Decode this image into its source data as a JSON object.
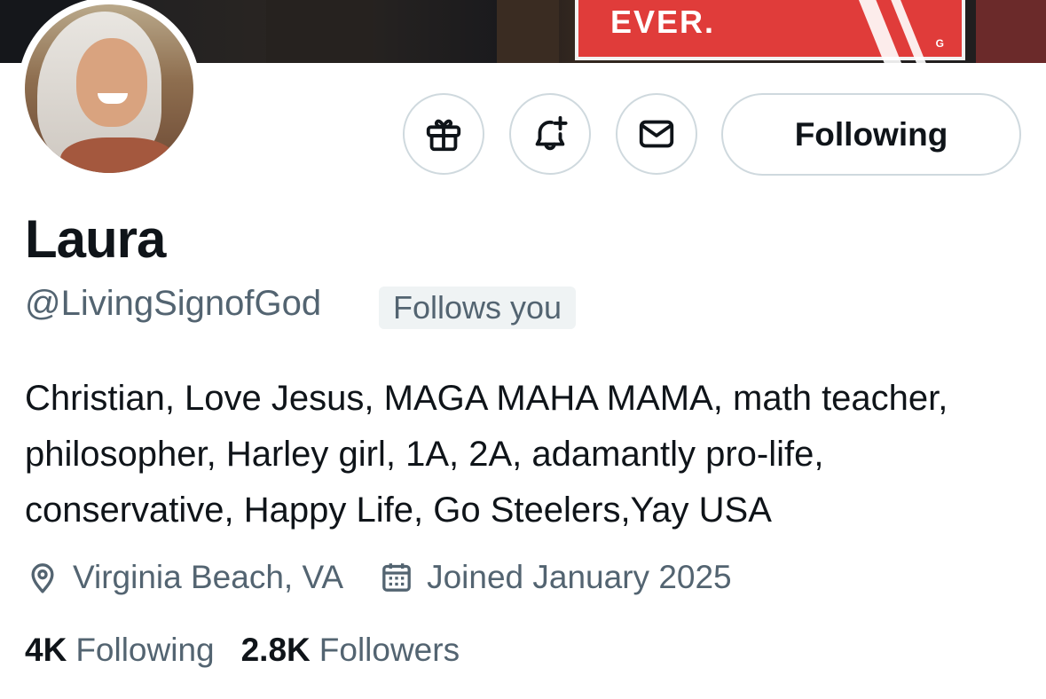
{
  "banner": {
    "sign_text": "EVER."
  },
  "profile": {
    "display_name": "Laura",
    "handle": "@LivingSignofGod",
    "follows_you_badge": "Follows you",
    "bio": "Christian, Love Jesus, MAGA MAHA MAMA, math teacher, philosopher, Harley girl, 1A, 2A, adamantly pro-life, conservative, Happy Life, Go Steelers,Yay USA",
    "location": "Virginia Beach, VA",
    "joined": "Joined January 2025"
  },
  "actions": {
    "gift_icon": "gift-icon",
    "notify_icon": "bell-plus-icon",
    "message_icon": "envelope-icon",
    "follow_label": "Following"
  },
  "stats": {
    "following_count": "4K",
    "following_label": "Following",
    "followers_count": "2.8K",
    "followers_label": "Followers"
  },
  "colors": {
    "text_primary": "#0f1419",
    "text_secondary": "#536471",
    "border": "#cfd9de",
    "badge_bg": "#eff3f4"
  }
}
